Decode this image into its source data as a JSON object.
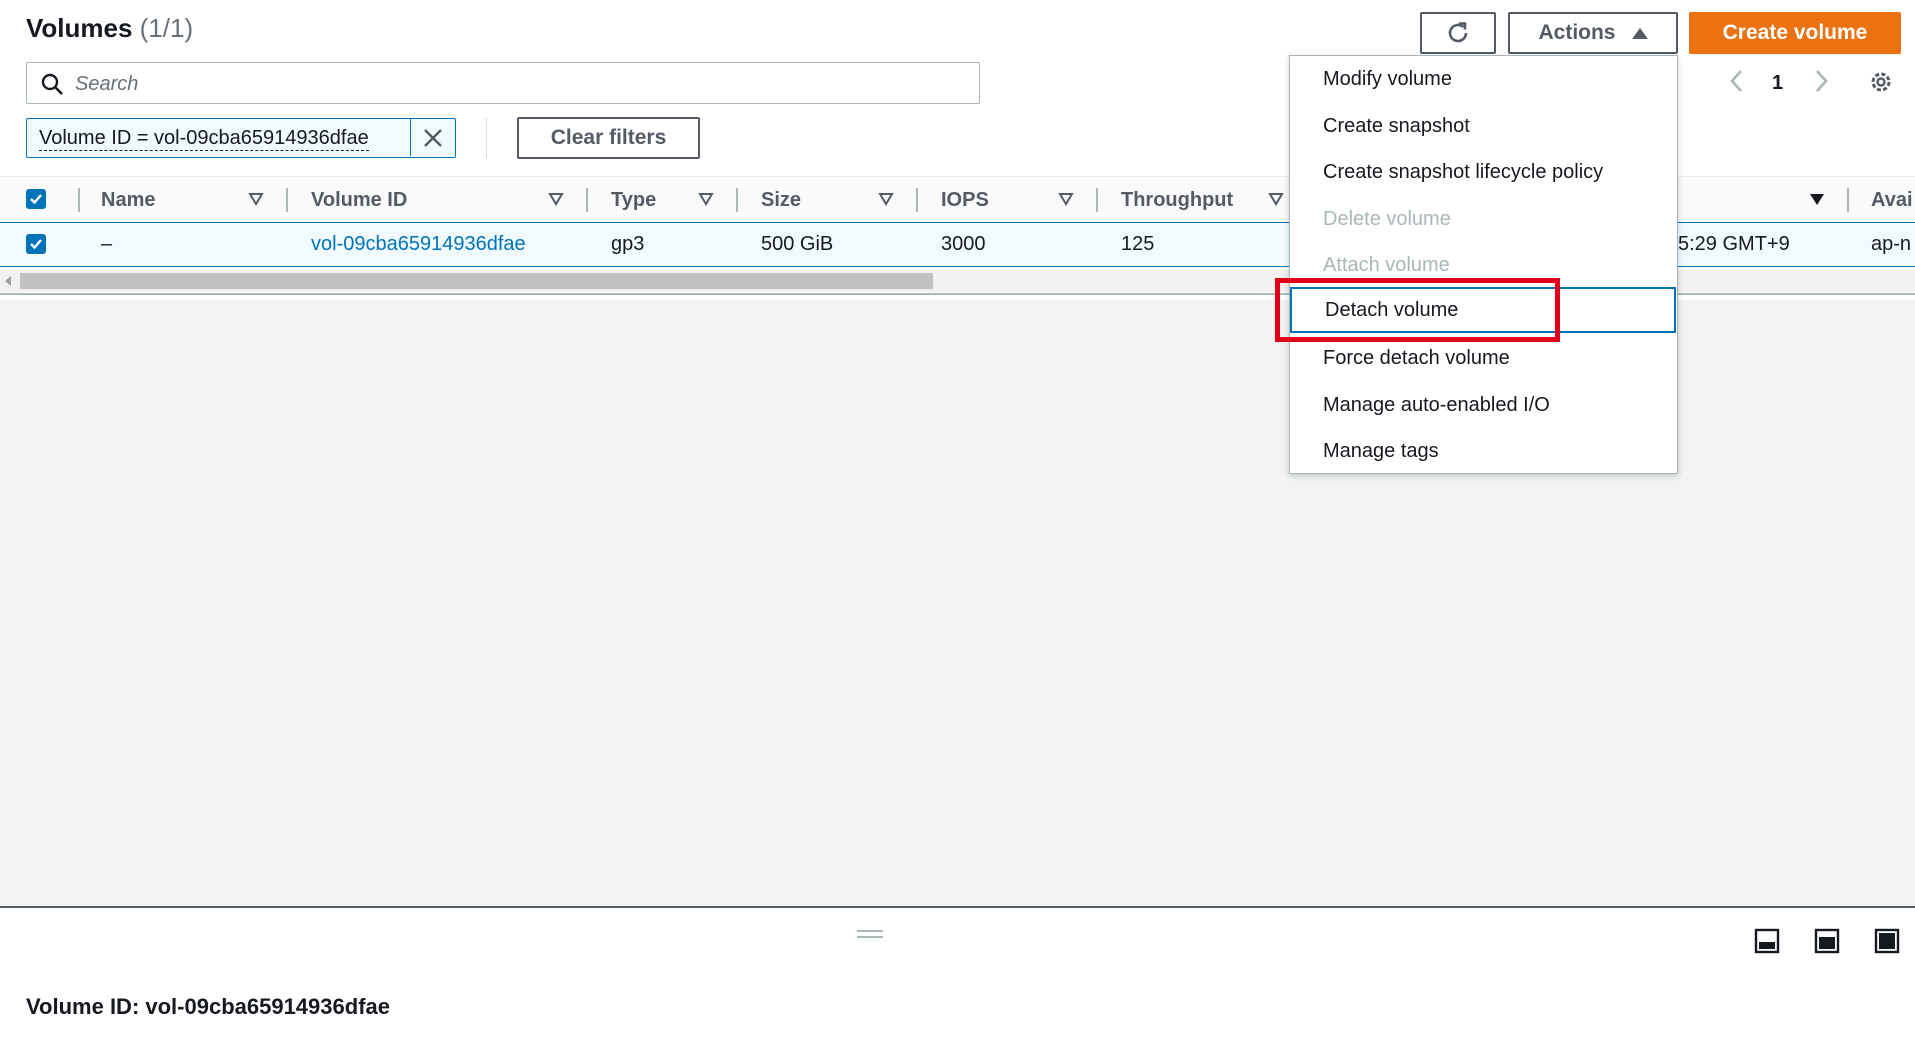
{
  "header": {
    "title": "Volumes",
    "count": "(1/1)",
    "actions_label": "Actions",
    "create_label": "Create volume"
  },
  "search": {
    "placeholder": "Search"
  },
  "filter": {
    "token_label": "Volume ID = vol-09cba65914936dfae",
    "clear_label": "Clear filters"
  },
  "pagination": {
    "current_page": "1"
  },
  "table": {
    "columns": [
      "Name",
      "Volume ID",
      "Type",
      "Size",
      "IOPS",
      "Throughput",
      "Avai"
    ],
    "rows": [
      {
        "name": "–",
        "volume_id": "vol-09cba65914936dfae",
        "type": "gp3",
        "size": "500 GiB",
        "iops": "3000",
        "throughput": "125",
        "created_partial": "5:29 GMT+9",
        "az_partial": "ap-n"
      }
    ]
  },
  "actions_menu": {
    "items": [
      {
        "label": "Modify volume",
        "disabled": false
      },
      {
        "label": "Create snapshot",
        "disabled": false
      },
      {
        "label": "Create snapshot lifecycle policy",
        "disabled": false
      },
      {
        "label": "Delete volume",
        "disabled": true
      },
      {
        "label": "Attach volume",
        "disabled": true
      },
      {
        "label": "Detach volume",
        "disabled": false
      },
      {
        "label": "Force detach volume",
        "disabled": false
      },
      {
        "label": "Manage auto-enabled I/O",
        "disabled": false
      },
      {
        "label": "Manage tags",
        "disabled": false
      }
    ]
  },
  "split_panel": {
    "title": "Volume ID: vol-09cba65914936dfae"
  },
  "colors": {
    "accent": "#0073bb",
    "primary_button": "#ec7211",
    "highlight": "#e0001b"
  }
}
